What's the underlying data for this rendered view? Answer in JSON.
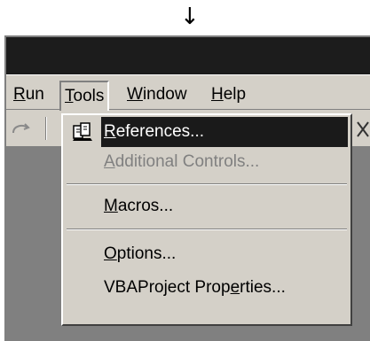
{
  "arrow": "↓",
  "menubar": {
    "run": {
      "u": "R",
      "rest": "un"
    },
    "tools": {
      "u": "T",
      "rest": "ools"
    },
    "window": {
      "u": "W",
      "rest": "indow"
    },
    "help": {
      "u": "H",
      "rest": "elp"
    }
  },
  "toolbar": {
    "redo_icon": "redo-icon",
    "right_icon": "cross-tool-icon"
  },
  "tools_menu": {
    "references": {
      "u": "R",
      "rest": "eferences..."
    },
    "additional_controls": {
      "u": "A",
      "rest": "dditional Controls..."
    },
    "macros": {
      "u": "M",
      "rest": "acros..."
    },
    "options": {
      "u": "O",
      "rest": "ptions..."
    },
    "vba_properties": {
      "pre": "VBAProject Prop",
      "u": "e",
      "post": "rties..."
    }
  },
  "colors": {
    "menu_bg": "#d4d0c8",
    "titlebar": "#1c1c1c",
    "highlight": "#1a1a1a",
    "workspace": "#808080",
    "disabled_text": "#808080"
  }
}
